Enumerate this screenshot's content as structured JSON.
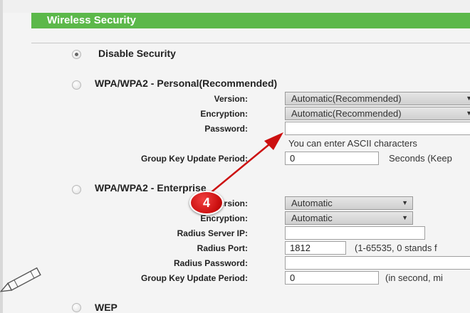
{
  "header": {
    "title": "Wireless Security"
  },
  "disable": {
    "label": "Disable Security",
    "checked": true
  },
  "personal": {
    "title": "WPA/WPA2 - Personal(Recommended)",
    "version_label": "Version:",
    "version_value": "Automatic(Recommended)",
    "encryption_label": "Encryption:",
    "encryption_value": "Automatic(Recommended)",
    "password_label": "Password:",
    "password_value": "",
    "password_hint": "You can enter ASCII characters",
    "gkup_label": "Group Key Update Period:",
    "gkup_value": "0",
    "gkup_hint": "Seconds (Keep"
  },
  "enterprise": {
    "title": "WPA/WPA2 - Enterprise",
    "version_label": "Version:",
    "version_value": "Automatic",
    "encryption_label": "Encryption:",
    "encryption_value": "Automatic",
    "radius_ip_label": "Radius Server IP:",
    "radius_ip_value": "",
    "radius_port_label": "Radius Port:",
    "radius_port_value": "1812",
    "radius_port_hint": "(1-65535, 0 stands f",
    "radius_pw_label": "Radius Password:",
    "radius_pw_value": "",
    "gkup_label": "Group Key Update Period:",
    "gkup_value": "0",
    "gkup_hint": "(in second, mi"
  },
  "wep": {
    "title": "WEP"
  },
  "annotation": {
    "step": "4",
    "color": "#cc1010"
  },
  "colors": {
    "header_green": "#5cb84a"
  }
}
